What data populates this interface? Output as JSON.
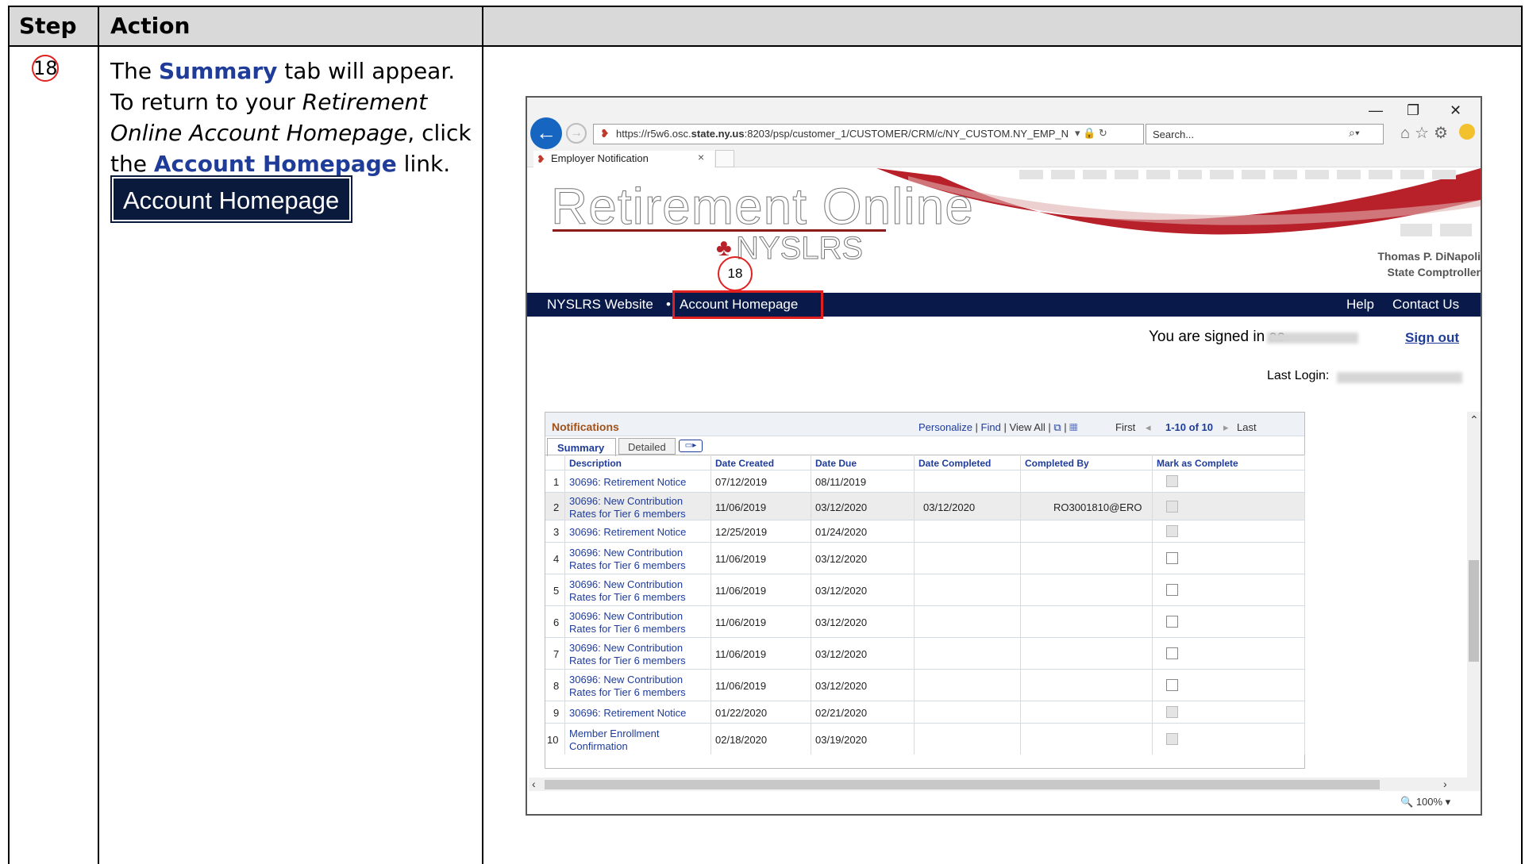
{
  "doc": {
    "col_step": "Step",
    "col_action": "Action",
    "step_number": "18",
    "action": {
      "line1_a": "The ",
      "line1_b": "Summary",
      "line1_c": " tab will appear.",
      "line2": "To return to your ",
      "line2_i": "Retirement",
      "line3_i": "Online Account Homepage",
      "line3_b": ", click",
      "line4_a": "the ",
      "line4_b": "Account Homepage",
      "line4_c": " link.",
      "button_label": "Account Homepage"
    }
  },
  "browser": {
    "url_prefix": "https://r5w6.osc.",
    "url_bold": "state.ny.us",
    "url_rest": ":8203/psp/customer_1/CUSTOMER/CRM/c/NY_CUSTOM.NY_EMP_N",
    "search_placeholder": "Search...",
    "tab_title": "Employer Notification",
    "zoom": "100%"
  },
  "site": {
    "logo_title": "Retirement Online",
    "logo_sub": "NYSLRS",
    "comptroller_name": "Thomas P. DiNapoli",
    "comptroller_title": "State Comptroller",
    "annotation": "18",
    "nav_website": "NYSLRS Website",
    "nav_home": "Account Homepage",
    "nav_help": "Help",
    "nav_contact": "Contact Us",
    "signed_in": "You are signed in as",
    "sign_out": "Sign out",
    "last_login": "Last Login:"
  },
  "grid": {
    "title": "Notifications",
    "personalize": "Personalize",
    "find": "Find",
    "view_all": "View All",
    "first": "First",
    "range": "1-10 of 10",
    "last": "Last",
    "tab_summary": "Summary",
    "tab_detailed": "Detailed",
    "headers": [
      "Description",
      "Date Created",
      "Date Due",
      "Date Completed",
      "Completed By",
      "Mark as Complete"
    ],
    "rows": [
      {
        "n": "1",
        "desc1": "30696: Retirement Notice",
        "desc2": "",
        "created": "07/12/2019",
        "due": "08/11/2019",
        "completed": "",
        "by": "",
        "disabled": true
      },
      {
        "n": "2",
        "desc1": "30696: New Contribution",
        "desc2": "Rates for Tier 6 members",
        "created": "11/06/2019",
        "due": "03/12/2020",
        "completed": "03/12/2020",
        "by": "RO3001810@ERO",
        "disabled": true
      },
      {
        "n": "3",
        "desc1": "30696: Retirement Notice",
        "desc2": "",
        "created": "12/25/2019",
        "due": "01/24/2020",
        "completed": "",
        "by": "",
        "disabled": true
      },
      {
        "n": "4",
        "desc1": "30696: New Contribution",
        "desc2": "Rates for Tier 6 members",
        "created": "11/06/2019",
        "due": "03/12/2020",
        "completed": "",
        "by": "",
        "disabled": false
      },
      {
        "n": "5",
        "desc1": "30696: New Contribution",
        "desc2": "Rates for Tier 6 members",
        "created": "11/06/2019",
        "due": "03/12/2020",
        "completed": "",
        "by": "",
        "disabled": false
      },
      {
        "n": "6",
        "desc1": "30696: New Contribution",
        "desc2": "Rates for Tier 6 members",
        "created": "11/06/2019",
        "due": "03/12/2020",
        "completed": "",
        "by": "",
        "disabled": false
      },
      {
        "n": "7",
        "desc1": "30696: New Contribution",
        "desc2": "Rates for Tier 6 members",
        "created": "11/06/2019",
        "due": "03/12/2020",
        "completed": "",
        "by": "",
        "disabled": false
      },
      {
        "n": "8",
        "desc1": "30696: New Contribution",
        "desc2": "Rates for Tier 6 members",
        "created": "11/06/2019",
        "due": "03/12/2020",
        "completed": "",
        "by": "",
        "disabled": false
      },
      {
        "n": "9",
        "desc1": "30696: Retirement Notice",
        "desc2": "",
        "created": "01/22/2020",
        "due": "02/21/2020",
        "completed": "",
        "by": "",
        "disabled": true
      },
      {
        "n": "10",
        "desc1": "Member Enrollment",
        "desc2": "Confirmation",
        "created": "02/18/2020",
        "due": "03/19/2020",
        "completed": "",
        "by": "",
        "disabled": true
      }
    ]
  }
}
